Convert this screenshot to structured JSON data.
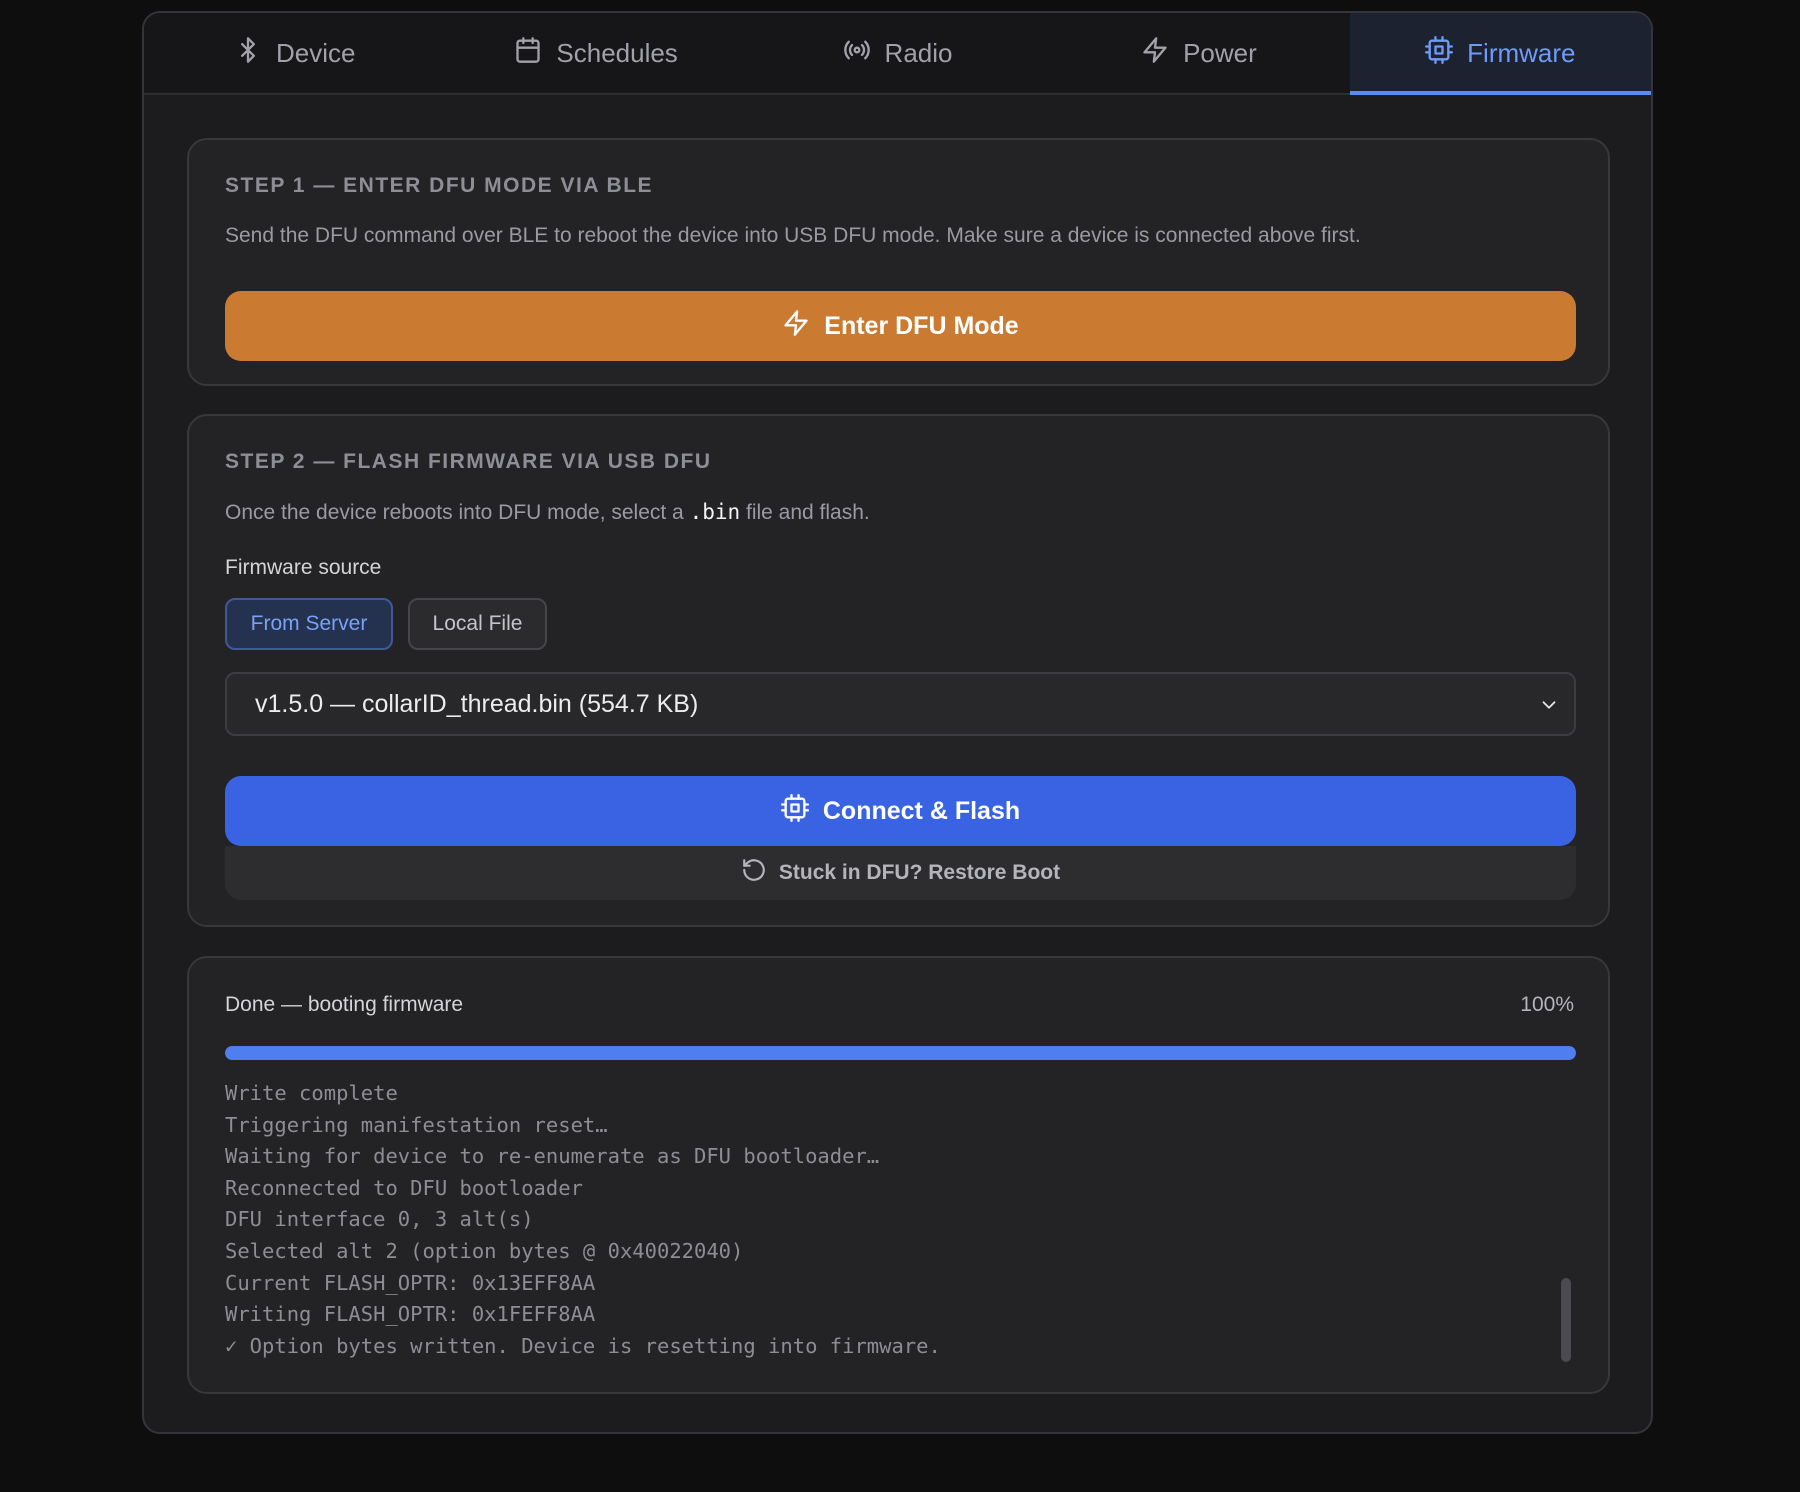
{
  "tabs": [
    {
      "label": "Device",
      "icon": "bluetooth-icon",
      "active": false
    },
    {
      "label": "Schedules",
      "icon": "calendar-icon",
      "active": false
    },
    {
      "label": "Radio",
      "icon": "radio-icon",
      "active": false
    },
    {
      "label": "Power",
      "icon": "lightning-icon",
      "active": false
    },
    {
      "label": "Firmware",
      "icon": "chip-icon",
      "active": true
    }
  ],
  "step1": {
    "title": "STEP 1 — ENTER DFU MODE VIA BLE",
    "description": "Send the DFU command over BLE to reboot the device into USB DFU mode. Make sure a device is connected above first.",
    "button_label": "Enter DFU Mode"
  },
  "step2": {
    "title": "STEP 2 — FLASH FIRMWARE VIA USB DFU",
    "description_before": "Once the device reboots into DFU mode, select a ",
    "description_code": ".bin",
    "description_after": " file and flash.",
    "source_label": "Firmware source",
    "source_options": [
      "From Server",
      "Local File"
    ],
    "selected_source": "From Server",
    "selected_firmware": "v1.5.0 — collarID_thread.bin (554.7 KB)",
    "flash_button_label": "Connect & Flash",
    "restore_button_label": "Stuck in DFU? Restore Boot"
  },
  "progress": {
    "status": "Done — booting firmware",
    "percent_label": "100%",
    "value": 1.0,
    "log": [
      "Write complete",
      "Triggering manifestation reset…",
      "Waiting for device to re-enumerate as DFU bootloader…",
      "Reconnected to DFU bootloader",
      "DFU interface 0, 3 alt(s)",
      "Selected alt 2 (option bytes @ 0x40022040)",
      "Current FLASH_OPTR: 0x13EFF8AA",
      "Writing FLASH_OPTR: 0x1FEFF8AA",
      "✓ Option bytes written. Device is resetting into firmware."
    ]
  },
  "colors": {
    "accent_blue": "#3a63e3",
    "accent_orange": "#cb7b31",
    "active_tab": "#6e9bf6",
    "progress_fill": "#4f7ef0"
  }
}
